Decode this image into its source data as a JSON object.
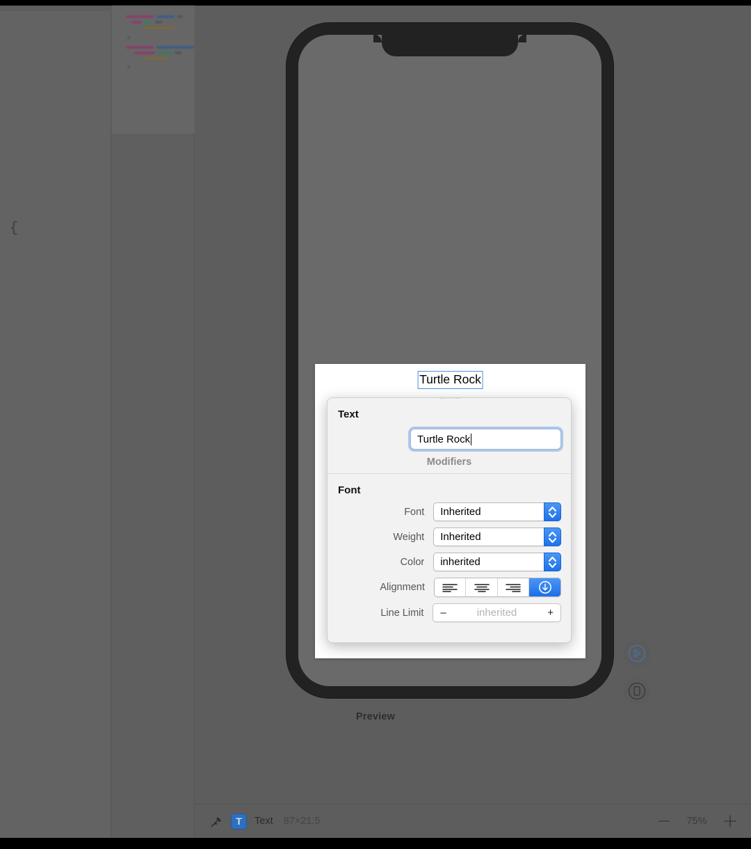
{
  "canvas": {
    "preview_label": "Preview",
    "selected_text": "Turtle Rock",
    "brace": "{"
  },
  "floating_controls": [
    {
      "name": "live-preview-button",
      "icon": "play-circle-icon"
    },
    {
      "name": "device-settings-button",
      "icon": "device-circle-icon"
    }
  ],
  "popover": {
    "text_section": {
      "title": "Text",
      "field_value": "Turtle Rock"
    },
    "modifiers_label": "Modifiers",
    "font_section": {
      "title": "Font",
      "rows": [
        {
          "label": "Font",
          "value": "Inherited",
          "control": "popup-button"
        },
        {
          "label": "Weight",
          "value": "Inherited",
          "control": "popup-button"
        },
        {
          "label": "Color",
          "value": "inherited",
          "control": "popup-button"
        }
      ],
      "alignment": {
        "label": "Alignment",
        "options": [
          "align-left-icon",
          "align-center-icon",
          "align-right-icon",
          "inherited-icon"
        ],
        "selected_index": 3
      },
      "line_limit": {
        "label": "Line Limit",
        "minus": "–",
        "value": "inherited",
        "plus": "+"
      }
    }
  },
  "status_bar": {
    "pin_icon": "pushpin-icon",
    "type_badge": "T",
    "element_name": "Text",
    "dimensions": "87×21.5",
    "zoom_out": "—",
    "zoom_level": "75%",
    "zoom_in": "+"
  },
  "colors": {
    "accent_blue": "#2f7ef0",
    "selection_border": "#4a90e2",
    "canvas_bg": "#5d5d5d",
    "device_frame": "#222222",
    "popover_bg": "#f2f2f2"
  }
}
